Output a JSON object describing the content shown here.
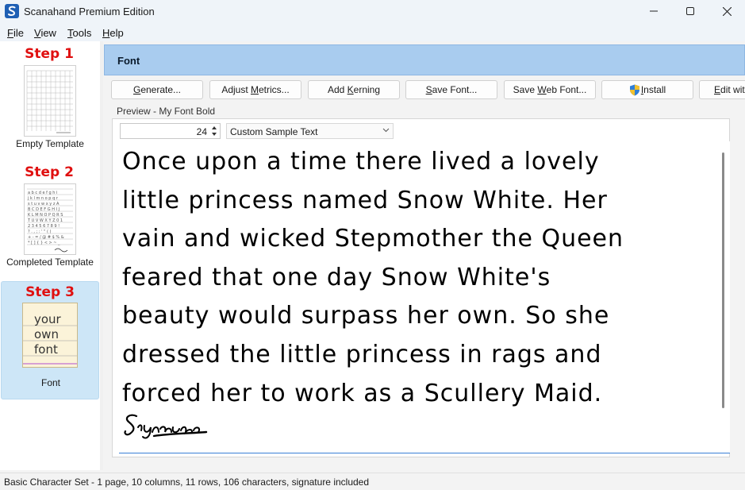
{
  "app": {
    "title": "Scanahand Premium Edition"
  },
  "menu": [
    {
      "label": "File",
      "accel": "F",
      "rest": "ile"
    },
    {
      "label": "View",
      "accel": "V",
      "rest": "iew"
    },
    {
      "label": "Tools",
      "accel": "T",
      "rest": "ools"
    },
    {
      "label": "Help",
      "accel": "H",
      "rest": "elp"
    }
  ],
  "steps": [
    {
      "title": "Step 1",
      "caption": "Empty Template",
      "selected": false
    },
    {
      "title": "Step 2",
      "caption": "Completed Template",
      "selected": false
    },
    {
      "title": "Step 3",
      "caption": "Font",
      "selected": true,
      "thumb_words": [
        "your",
        "own",
        "font"
      ]
    }
  ],
  "panel": {
    "header": "Font",
    "toolbar": [
      {
        "pre": "",
        "accel": "G",
        "post": "enerate...",
        "label": "Generate..."
      },
      {
        "pre": "Adjust ",
        "accel": "M",
        "post": "etrics...",
        "label": "Adjust Metrics..."
      },
      {
        "pre": "Add ",
        "accel": "K",
        "post": "erning",
        "label": "Add Kerning"
      },
      {
        "pre": "",
        "accel": "S",
        "post": "ave Font...",
        "label": "Save Font..."
      },
      {
        "pre": "Save ",
        "accel": "W",
        "post": "eb Font...",
        "label": "Save Web Font..."
      },
      {
        "pre": "",
        "accel": "I",
        "post": "nstall",
        "label": "Install"
      },
      {
        "pre": "",
        "accel": "E",
        "post": "dit wit",
        "label": "Edit wit"
      }
    ],
    "preview_label": "Preview - My Font Bold",
    "size_value": "24",
    "sample_select": "Custom Sample Text",
    "preview_lines": [
      "Once upon a time there lived a lovely",
      "little princess named Snow White. Her",
      "vain and wicked Stepmother the Queen",
      "feared that one day Snow White's",
      "beauty would surpass her own. So she",
      "dressed the little princess in rags and",
      "forced her to work as a Scullery Maid."
    ]
  },
  "status": "Basic Character Set - 1 page, 10 columns, 11 rows, 106 characters, signature included",
  "colors": {
    "accent_header": "#a9ccef",
    "step_title": "#e01010",
    "selected_step": "#cde6f7"
  }
}
